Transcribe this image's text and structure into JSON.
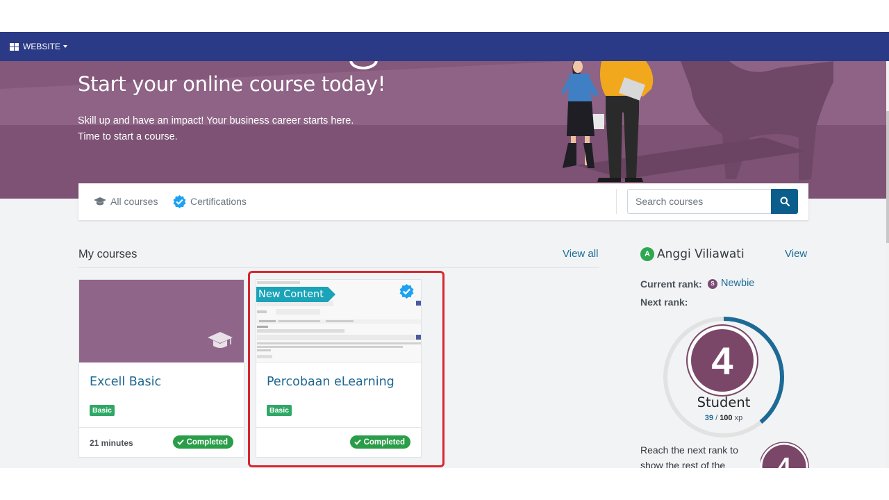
{
  "topbar": {
    "website_label": "WEBSITE"
  },
  "hero": {
    "title": "Start your online course today!",
    "subtitle_line1": "Skill up and have an impact! Your business career starts here.",
    "subtitle_line2": "Time to start a course."
  },
  "nav": {
    "all_courses": "All courses",
    "certifications": "Certifications",
    "search_placeholder": "Search courses"
  },
  "my_courses": {
    "title": "My courses",
    "view_all": "View all",
    "courses": [
      {
        "title": "Excell Basic",
        "tag": "Basic",
        "duration": "21 minutes",
        "status": "Completed"
      },
      {
        "title": "Percobaan eLearning",
        "tag": "Basic",
        "duration": "",
        "status": "Completed",
        "ribbon": "New Content"
      }
    ]
  },
  "profile": {
    "avatar_letter": "A",
    "name": "Anggi Viliawati",
    "view": "View",
    "current_rank_label": "Current rank:",
    "current_rank_icon_letter": "S",
    "current_rank": "Newbie",
    "next_rank_label": "Next rank:",
    "next_rank_number": "4",
    "next_rank_name": "Student",
    "xp_current": "39",
    "xp_sep": "/",
    "xp_total": "100",
    "xp_unit": "xp",
    "xp_progress_fraction": 0.39,
    "reach_text": "Reach the next rank to show the rest of the"
  },
  "colors": {
    "topbar": "#2b3a86",
    "hero": "#84587a",
    "link": "#1a6b95",
    "badge_green": "#2fa866",
    "highlight": "#d9262e"
  }
}
